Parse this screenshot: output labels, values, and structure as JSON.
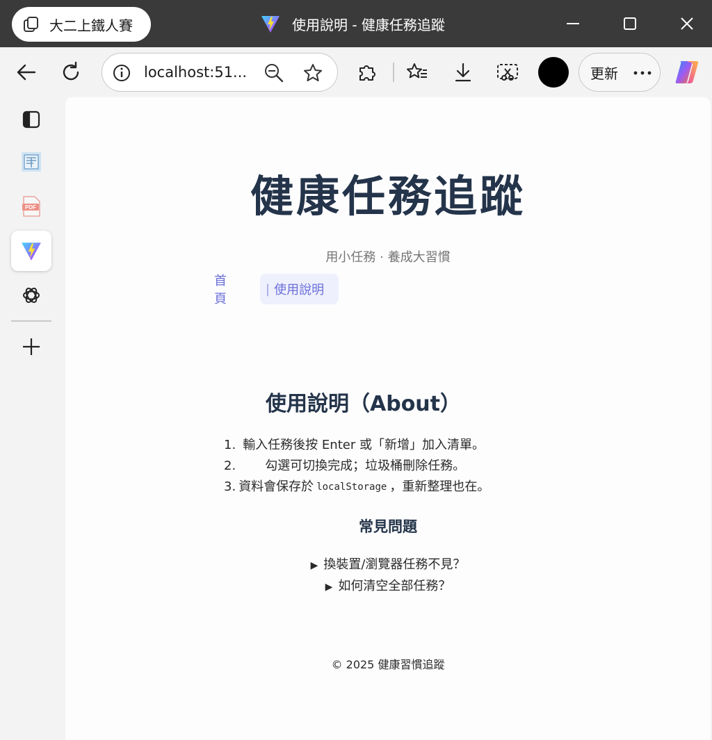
{
  "window": {
    "profile_name": "大二上鐵人賽",
    "tab_title": "使用說明 - 健康任務追蹤",
    "minimize_icon": "minimize-icon",
    "maximize_icon": "maximize-icon",
    "close_icon": "close-icon"
  },
  "toolbar": {
    "url": "localhost:51...",
    "update_label": "更新",
    "icons": [
      "back-arrow-icon",
      "refresh-icon",
      "info-icon",
      "zoom-out-icon",
      "star-icon",
      "extensions-icon",
      "favorites-icon",
      "download-icon",
      "screenshot-icon",
      "more-icon",
      "copilot-icon"
    ]
  },
  "sidebar": {
    "items": [
      "vertical-tabs-icon",
      "document-app-icon",
      "pdf-icon",
      "vite-app-icon",
      "chatgpt-icon",
      "add-icon"
    ]
  },
  "page": {
    "title": "健康任務追蹤",
    "subtitle": "用小任務 · 養成大習慣",
    "nav": {
      "home": "首頁",
      "separator": "|",
      "about": "使用說明"
    },
    "about_heading": "使用說明（About）",
    "steps": [
      {
        "num": "1.",
        "text": "輸入任務後按 Enter 或「新增」加入清單。"
      },
      {
        "num": "2.",
        "text": "勾選可切換完成；垃圾桶刪除任務。"
      },
      {
        "num": "3.",
        "text_before": "資料會保存於",
        "code": "localStorage",
        "text_after": "，重新整理也在。"
      }
    ],
    "faq_heading": "常見問題",
    "faq": [
      {
        "marker": "▶",
        "question": "換裝置/瀏覽器任務不見？"
      },
      {
        "marker": "▶",
        "question": "如何清空全部任務？"
      }
    ],
    "footer": "© 2025 健康習慣追蹤"
  },
  "colors": {
    "title": "#24344a",
    "accent": "#6b6fd8",
    "nav_active_bg": "#eef0fd",
    "titlebar_bg": "#3a3a3a"
  }
}
